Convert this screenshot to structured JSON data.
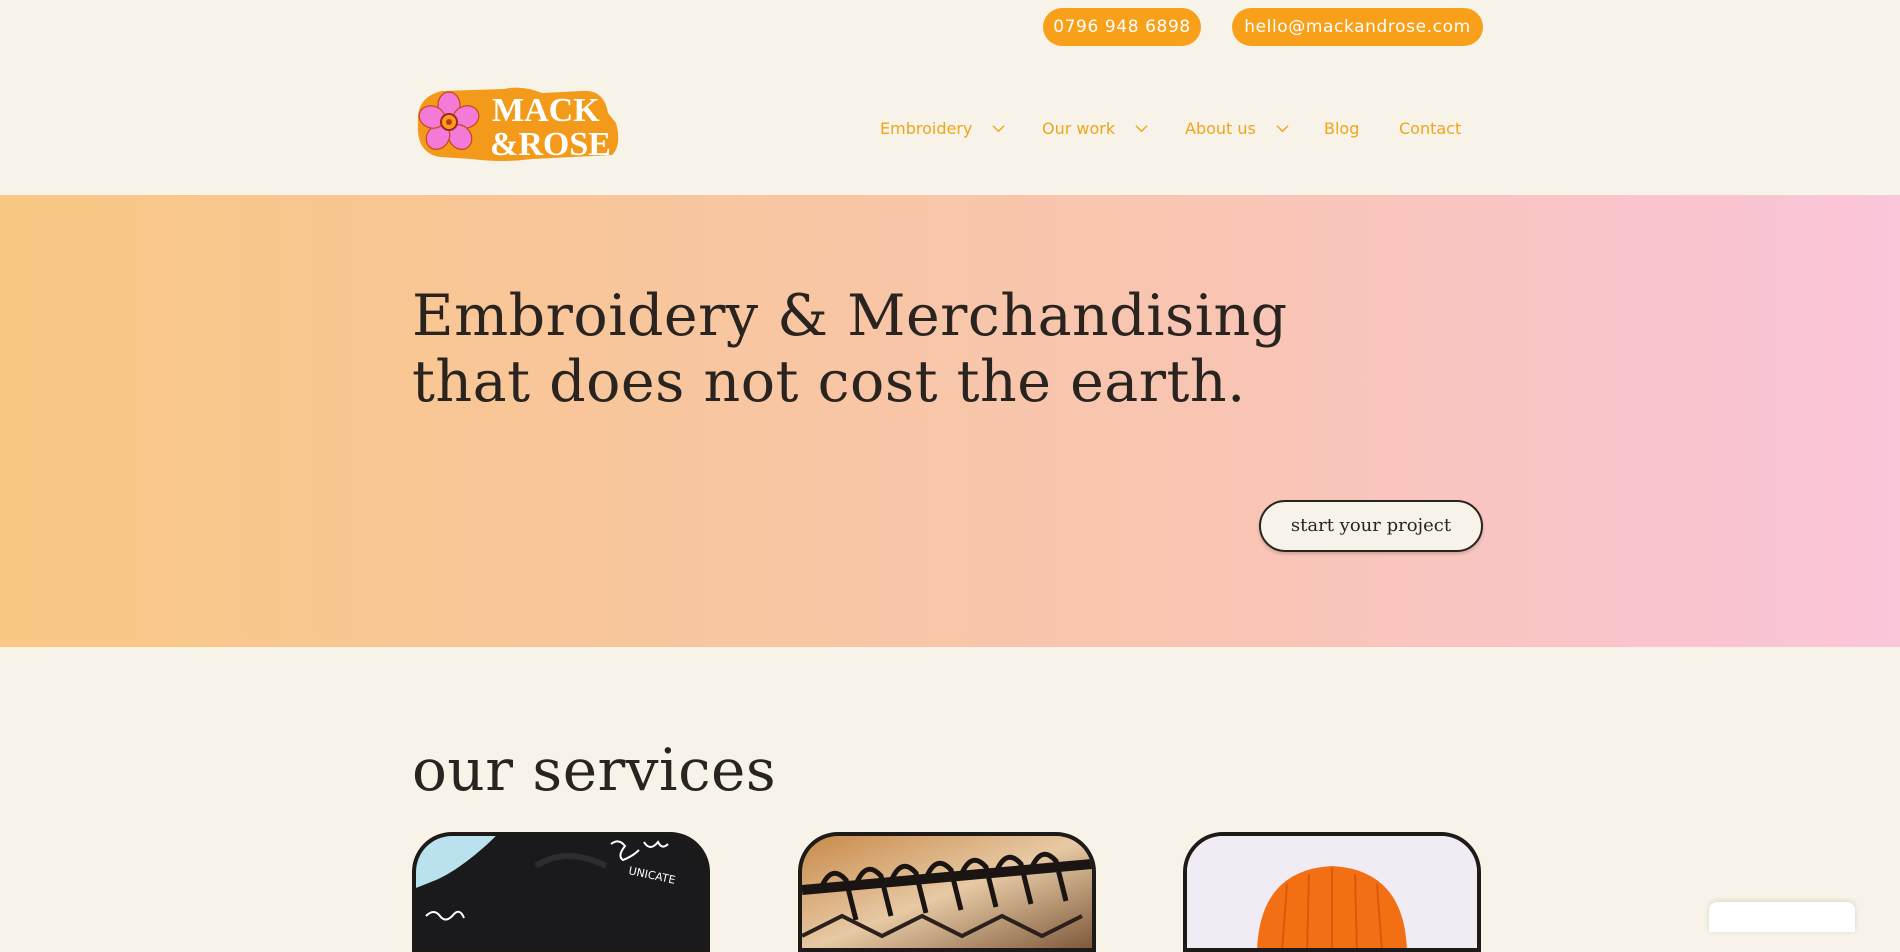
{
  "topbar": {
    "phone": "0796 948 6898",
    "email": "hello@mackandrose.com",
    "accent": "#f9a01b"
  },
  "brand": {
    "logo_line1": "MACK",
    "logo_line2": "&ROSE",
    "logo_colors": {
      "orange": "#f49a1a",
      "pink": "#f47ad7"
    }
  },
  "nav": [
    {
      "label": "Embroidery",
      "has_dropdown": true
    },
    {
      "label": "Our work",
      "has_dropdown": true
    },
    {
      "label": "About us",
      "has_dropdown": true
    },
    {
      "label": "Blog",
      "has_dropdown": false
    },
    {
      "label": "Contact",
      "has_dropdown": false
    }
  ],
  "hero": {
    "headline_line1": "Embroidery & Merchandising",
    "headline_line2": "that does not cost the earth.",
    "cta_label": "start your project",
    "gradient": [
      "#f9c884",
      "#fbc5da"
    ]
  },
  "services": {
    "title": "our services",
    "cards": [
      {
        "image": "embroidered-black-garment",
        "overlay_text": "UNICATE"
      },
      {
        "image": "clothing-rack-hangers"
      },
      {
        "image": "orange-beanie"
      }
    ]
  }
}
